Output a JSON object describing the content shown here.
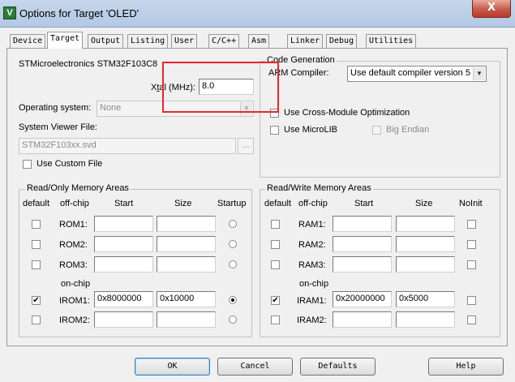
{
  "window": {
    "title": "Options for Target 'OLED'",
    "icon_letter": "V",
    "close_label": "X"
  },
  "tabs": [
    {
      "label": "Device",
      "active": false
    },
    {
      "label": "Target",
      "active": true
    },
    {
      "label": "Output",
      "active": false
    },
    {
      "label": "Listing",
      "active": false
    },
    {
      "label": "User",
      "active": false
    },
    {
      "label": "C/C++",
      "active": false
    },
    {
      "label": "Asm",
      "active": false
    },
    {
      "label": "Linker",
      "active": false
    },
    {
      "label": "Debug",
      "active": false
    },
    {
      "label": "Utilities",
      "active": false
    }
  ],
  "target": {
    "device_name": "STMicroelectronics STM32F103C8",
    "xtal_label_prefix": "X",
    "xtal_label_underlined": "t",
    "xtal_label_suffix": "al (MHz):",
    "xtal_value": "8.0",
    "os_label": "Operating system:",
    "os_value": "None",
    "svf_label": "System Viewer File:",
    "svf_value": "STM32F103xx.svd",
    "svf_browse": "...",
    "custom_file_label": "Use Custom File",
    "custom_file_checked": false
  },
  "codegen": {
    "title": "Code Generation",
    "compiler_label": "ARM Compiler:",
    "compiler_value": "Use default compiler version 5",
    "cross_module_label": "Use Cross-Module Optimization",
    "cross_module_checked": false,
    "microlib_label": "Use MicroLIB",
    "microlib_checked": false,
    "big_endian_label": "Big Endian",
    "big_endian_checked": false
  },
  "rom": {
    "title": "Read/Only Memory Areas",
    "headers": {
      "default": "default",
      "offchip": "off-chip",
      "start": "Start",
      "size": "Size",
      "startup": "Startup"
    },
    "onchip_label": "on-chip",
    "rows": [
      {
        "name": "ROM1:",
        "checked": false,
        "start": "",
        "size": "",
        "startup": false
      },
      {
        "name": "ROM2:",
        "checked": false,
        "start": "",
        "size": "",
        "startup": false
      },
      {
        "name": "ROM3:",
        "checked": false,
        "start": "",
        "size": "",
        "startup": false
      },
      {
        "name": "IROM1:",
        "checked": true,
        "start": "0x8000000",
        "size": "0x10000",
        "startup": true
      },
      {
        "name": "IROM2:",
        "checked": false,
        "start": "",
        "size": "",
        "startup": false
      }
    ]
  },
  "ram": {
    "title": "Read/Write Memory Areas",
    "headers": {
      "default": "default",
      "offchip": "off-chip",
      "start": "Start",
      "size": "Size",
      "noinit": "NoInit"
    },
    "onchip_label": "on-chip",
    "rows": [
      {
        "name": "RAM1:",
        "checked": false,
        "start": "",
        "size": "",
        "noinit": false
      },
      {
        "name": "RAM2:",
        "checked": false,
        "start": "",
        "size": "",
        "noinit": false
      },
      {
        "name": "RAM3:",
        "checked": false,
        "start": "",
        "size": "",
        "noinit": false
      },
      {
        "name": "IRAM1:",
        "checked": true,
        "start": "0x20000000",
        "size": "0x5000",
        "noinit": false
      },
      {
        "name": "IRAM2:",
        "checked": false,
        "start": "",
        "size": "",
        "noinit": false
      }
    ]
  },
  "buttons": {
    "ok": "OK",
    "cancel": "Cancel",
    "defaults": "Defaults",
    "help": "Help"
  },
  "colors": {
    "highlight": "#e8262a",
    "dialog_bg": "#f0f0f0"
  }
}
